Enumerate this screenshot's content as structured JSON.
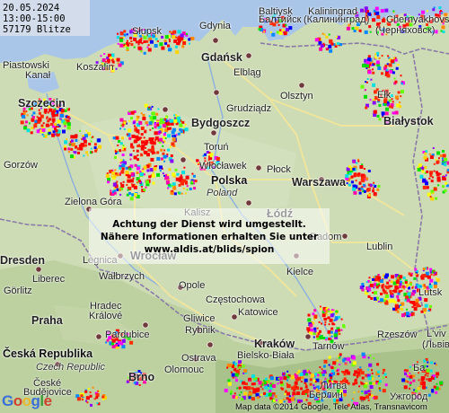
{
  "info": {
    "date": "20.05.2024",
    "time": "13:00-15:00",
    "count": "57179 Blitze"
  },
  "notice": {
    "line1": "Achtung der Dienst wird umgestellt.",
    "line2": "Nähere Informationen erhalten Sie unter",
    "line3": "www.aldis.at/blids/spion"
  },
  "cities": [
    {
      "name": "Słupsk",
      "cls": "city"
    },
    {
      "name": "Gdynia",
      "cls": "city"
    },
    {
      "name": "Gdańsk",
      "cls": "city big"
    },
    {
      "name": "Baltiysk",
      "cls": "city"
    },
    {
      "name": "Балтийск",
      "cls": "city"
    },
    {
      "name": "Kaliningrad",
      "cls": "city"
    },
    {
      "name": "(Калининград)",
      "cls": "city"
    },
    {
      "name": "Chernyakhovsk",
      "cls": "city"
    },
    {
      "name": "(Черняховск)",
      "cls": "city"
    },
    {
      "name": "Elbląg",
      "cls": "city"
    },
    {
      "name": "Olsztyn",
      "cls": "city"
    },
    {
      "name": "Koszalin",
      "cls": "city"
    },
    {
      "name": "Piastowski",
      "cls": "city"
    },
    {
      "name": "Kanał",
      "cls": "city"
    },
    {
      "name": "Szczecin",
      "cls": "city big"
    },
    {
      "name": "Grudziądz",
      "cls": "city"
    },
    {
      "name": "Bydgoszcz",
      "cls": "city big"
    },
    {
      "name": "Toruń",
      "cls": "city"
    },
    {
      "name": "Włocławek",
      "cls": "city"
    },
    {
      "name": "Płock",
      "cls": "city"
    },
    {
      "name": "Warszawa",
      "cls": "city big"
    },
    {
      "name": "Polska",
      "cls": "city country"
    },
    {
      "name": "Poland",
      "cls": "city it"
    },
    {
      "name": "Białystok",
      "cls": "city big"
    },
    {
      "name": "Ełk",
      "cls": "city"
    },
    {
      "name": "Gorzów",
      "cls": "city"
    },
    {
      "name": "Zielona Góra",
      "cls": "city"
    },
    {
      "name": "Kalisz",
      "cls": "city"
    },
    {
      "name": "Łódź",
      "cls": "city big"
    },
    {
      "name": "Radom",
      "cls": "city"
    },
    {
      "name": "Lublin",
      "cls": "city"
    },
    {
      "name": "Dresden",
      "cls": "city big"
    },
    {
      "name": "Legnica",
      "cls": "city"
    },
    {
      "name": "Wrocław",
      "cls": "city big"
    },
    {
      "name": "Kielce",
      "cls": "city"
    },
    {
      "name": "Görlitz",
      "cls": "city"
    },
    {
      "name": "Liberec",
      "cls": "city"
    },
    {
      "name": "Wałbrzych",
      "cls": "city"
    },
    {
      "name": "Opole",
      "cls": "city"
    },
    {
      "name": "Częstochowa",
      "cls": "city"
    },
    {
      "name": "Hradec",
      "cls": "city"
    },
    {
      "name": "Králové",
      "cls": "city"
    },
    {
      "name": "Praha",
      "cls": "city big"
    },
    {
      "name": "Gliwice",
      "cls": "city"
    },
    {
      "name": "Katowice",
      "cls": "city"
    },
    {
      "name": "Rybnik",
      "cls": "city"
    },
    {
      "name": "Pardubice",
      "cls": "city"
    },
    {
      "name": "Česká Republika",
      "cls": "city country"
    },
    {
      "name": "Czech Republic",
      "cls": "city it"
    },
    {
      "name": "Kraków",
      "cls": "city big"
    },
    {
      "name": "Tarnów",
      "cls": "city"
    },
    {
      "name": "Rzeszów",
      "cls": "city"
    },
    {
      "name": "Bielsko-Biała",
      "cls": "city"
    },
    {
      "name": "Ostrava",
      "cls": "city"
    },
    {
      "name": "Olomouc",
      "cls": "city"
    },
    {
      "name": "Brno",
      "cls": "city big"
    },
    {
      "name": "České",
      "cls": "city"
    },
    {
      "name": "Budějovice",
      "cls": "city"
    },
    {
      "name": "L'viv",
      "cls": "city"
    },
    {
      "name": "(Львів)",
      "cls": "city"
    },
    {
      "name": "Lutsk",
      "cls": "city"
    },
    {
      "name": "Ба",
      "cls": "city"
    },
    {
      "name": "Ужгород",
      "cls": "city"
    },
    {
      "name": "Берлин",
      "cls": "city"
    },
    {
      "name": "Литва",
      "cls": "city"
    }
  ],
  "logo": {
    "text": "Google",
    "colors": [
      "#3b6fd8",
      "#d0402c",
      "#e8b82a",
      "#3b6fd8",
      "#3d9b3d",
      "#d0402c"
    ]
  },
  "copyright": "Map data ©2014 Google, Tele Atlas, Transnavicom"
}
